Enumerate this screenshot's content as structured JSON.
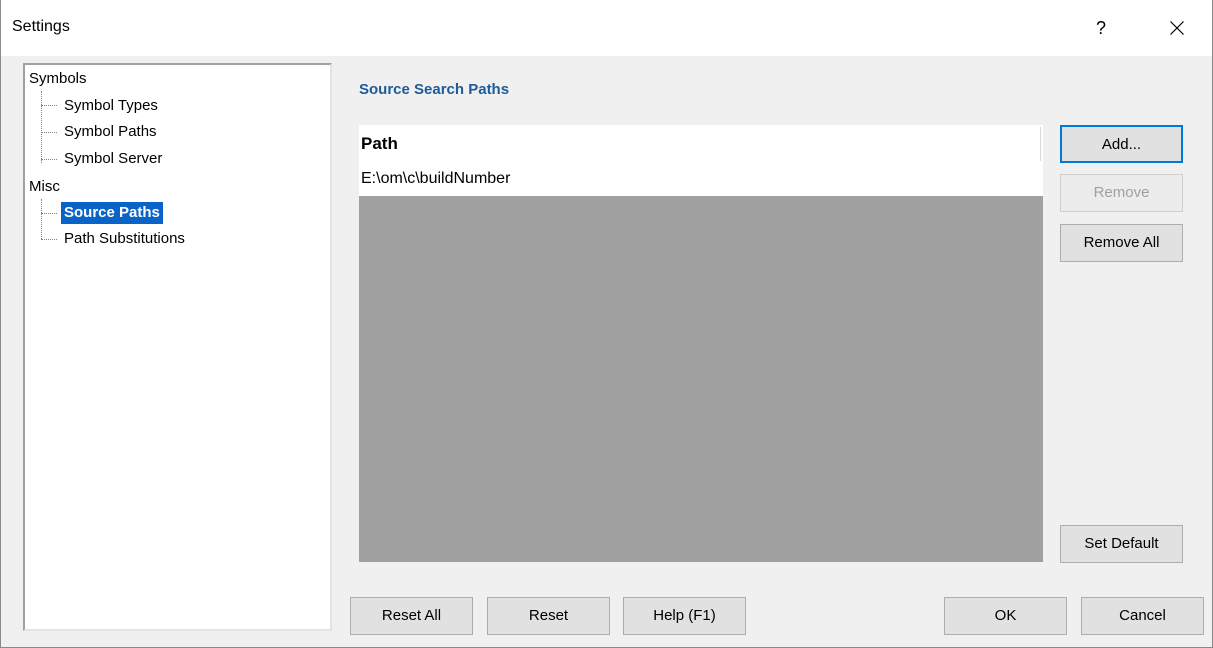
{
  "window": {
    "title": "Settings",
    "help_glyph": "?",
    "close_icon": "close-icon"
  },
  "tree": {
    "groups": [
      {
        "label": "Symbols",
        "children": [
          {
            "label": "Symbol Types",
            "selected": false
          },
          {
            "label": "Symbol Paths",
            "selected": false
          },
          {
            "label": "Symbol Server",
            "selected": false
          }
        ]
      },
      {
        "label": "Misc",
        "children": [
          {
            "label": "Source Paths",
            "selected": true
          },
          {
            "label": "Path Substitutions",
            "selected": false
          }
        ]
      }
    ]
  },
  "panel": {
    "title": "Source Search Paths",
    "list": {
      "column_header": "Path",
      "rows": [
        "E:\\om\\c\\buildNumber"
      ]
    }
  },
  "side_buttons": {
    "add": "Add...",
    "remove": "Remove",
    "remove_all": "Remove All",
    "set_default": "Set Default"
  },
  "bottom_buttons": {
    "reset_all": "Reset All",
    "reset": "Reset",
    "help": "Help (F1)",
    "ok": "OK",
    "cancel": "Cancel"
  },
  "colors": {
    "selection": "#0a64c8",
    "section_title": "#1d5c9a",
    "list_empty_area": "#a0a0a0",
    "default_button_border": "#0078d7"
  }
}
